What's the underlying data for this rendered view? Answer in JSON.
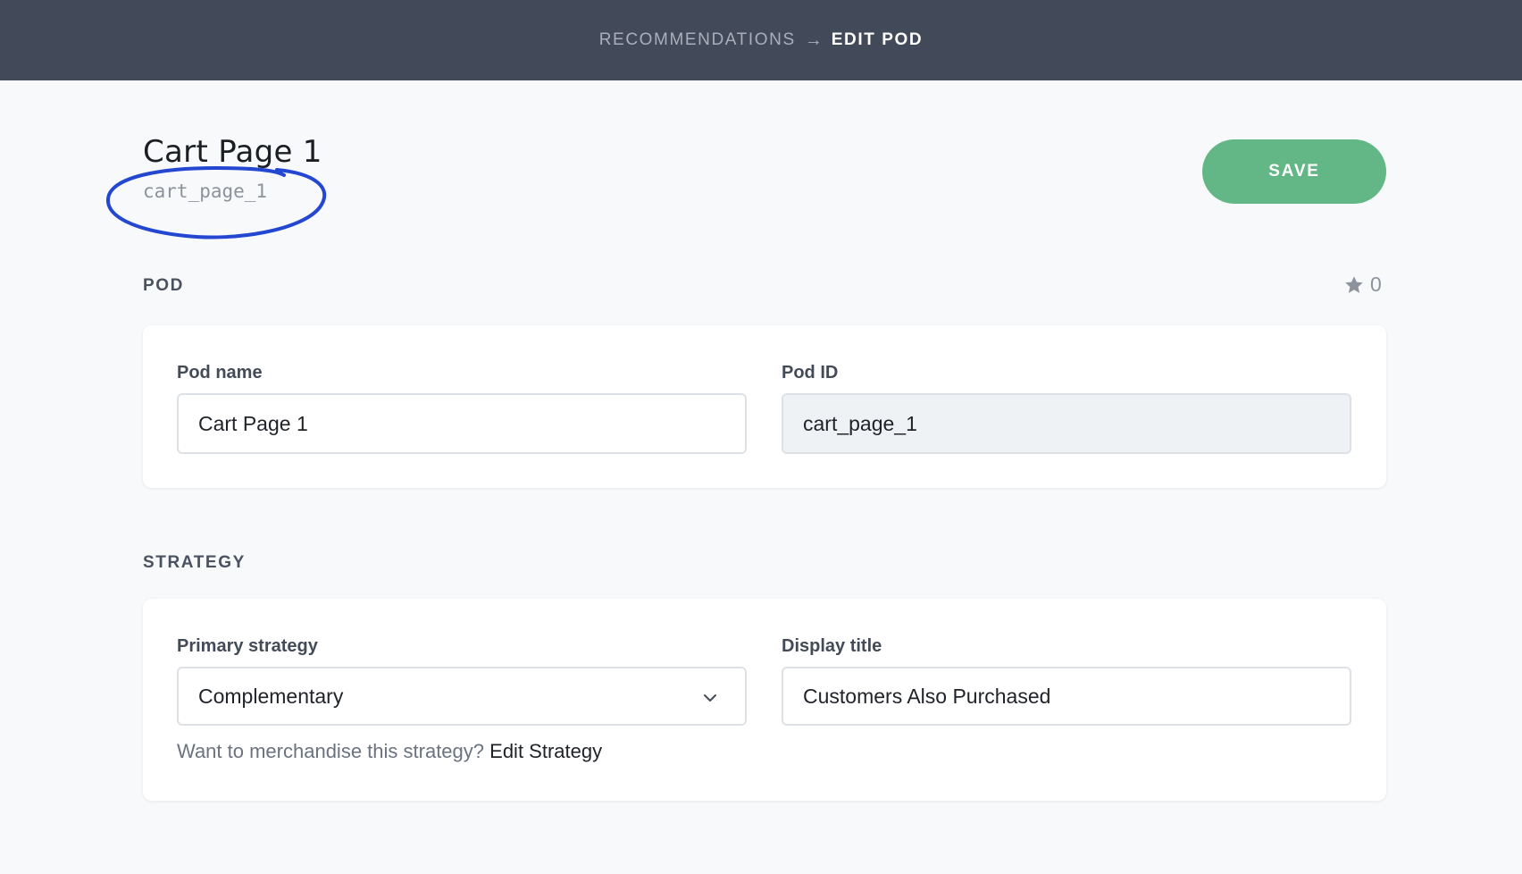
{
  "header": {
    "breadcrumb_parent": "RECOMMENDATIONS",
    "breadcrumb_separator": "→",
    "breadcrumb_current": "EDIT POD"
  },
  "page": {
    "title": "Cart Page 1",
    "subtitle": "cart_page_1",
    "save_label": "SAVE"
  },
  "pod_section": {
    "label": "POD",
    "star_count": "0",
    "pod_name_label": "Pod name",
    "pod_name_value": "Cart Page 1",
    "pod_id_label": "Pod ID",
    "pod_id_value": "cart_page_1"
  },
  "strategy_section": {
    "label": "STRATEGY",
    "primary_strategy_label": "Primary strategy",
    "primary_strategy_value": "Complementary",
    "display_title_label": "Display title",
    "display_title_value": "Customers Also Purchased",
    "helper_text": "Want to merchandise this strategy?",
    "helper_link": "Edit Strategy"
  },
  "colors": {
    "topbar": "#424a5a",
    "save_button": "#63b685",
    "annotation_ink": "#2347d1",
    "page_background": "#f7f9fa"
  },
  "icons": {
    "star": "star-icon",
    "chevron": "chevron-down-icon"
  }
}
